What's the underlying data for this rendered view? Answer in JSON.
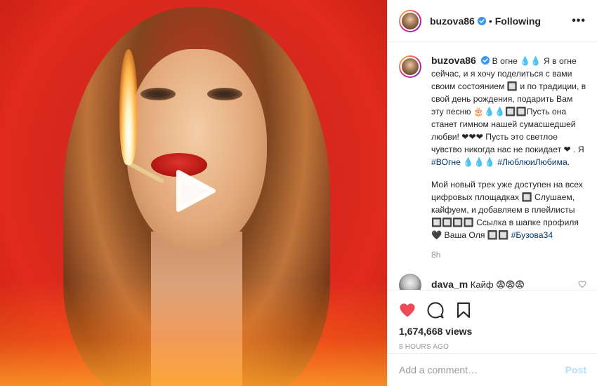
{
  "post": {
    "username": "buzova86",
    "follow_status": "Following",
    "more_label": "•••"
  },
  "caption": {
    "username": "buzova86",
    "part1": "В огне 💧💧 Я в огне сейчас, и я хочу поделиться с вами своим состоянием 🔲 и по традиции, в свой день рождения, подарить Вам эту песню 🎂💧💧🔲🔲Пусть она станет гимном нашей сумасшедшей любви! ❤❤❤ Пусть это светлое чувство никогда нас не покидает ❤ . Я",
    "tag1": "#ВОгне",
    "part2": "💧💧💧",
    "tag2": "#ЛюблюиЛюбима",
    "part3": ".",
    "paragraph2": "Мой новый трек уже доступен на всех цифровых площадках 🔲 Слушаем, кайфуем, и добавляем в плейлисты 🔲🔲🔲🔲 Ссылка в шапке профиля 🖤 Ваша Оля 🔲🔲",
    "tag3": "#Бузова34",
    "time": "8h"
  },
  "comment": {
    "username": "dava_m",
    "text": "Кайф 😨😨😨"
  },
  "stats": {
    "views": "1,674,668 views",
    "ago": "8 HOURS AGO"
  },
  "add_comment": {
    "placeholder": "Add a comment…",
    "post_label": "Post"
  },
  "icons": {
    "like": "heart-filled-icon",
    "comment": "comment-bubble-icon",
    "save": "bookmark-icon",
    "verified": "verified-badge-icon",
    "play": "play-icon",
    "comment_like": "heart-outline-icon"
  },
  "colors": {
    "like_red": "#ed4956",
    "verified_blue": "#3897f0",
    "hashtag": "#003569",
    "post_disabled": "#b2dffc"
  }
}
